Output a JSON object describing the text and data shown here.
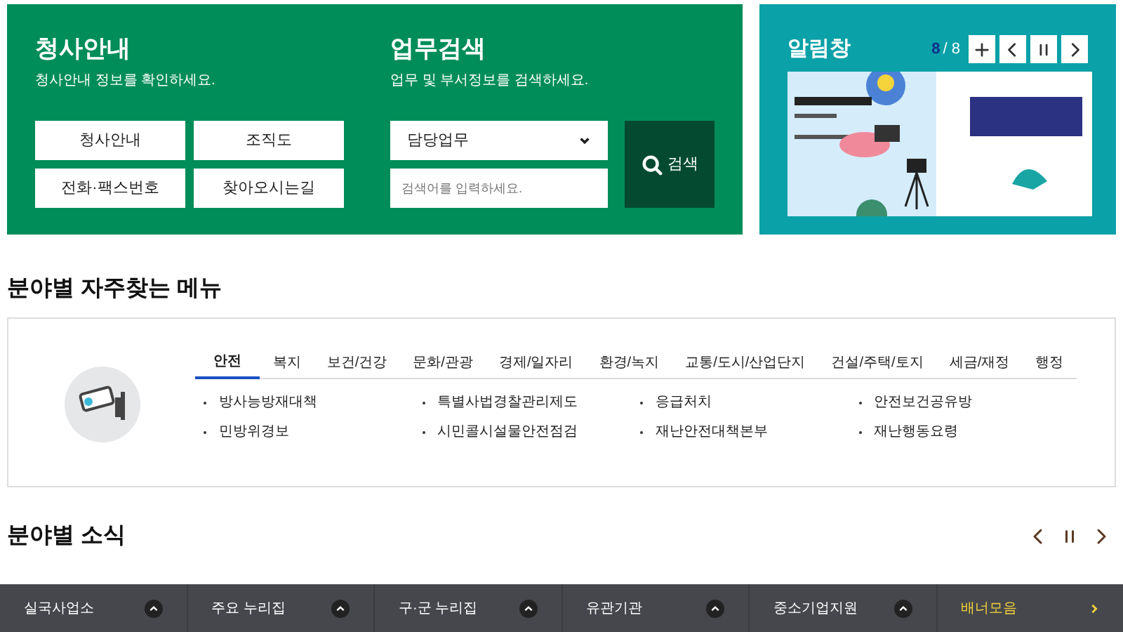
{
  "office": {
    "title": "청사안내",
    "subtitle": "청사안내 정보를 확인하세요.",
    "links": [
      "청사안내",
      "조직도",
      "전화·팩스번호",
      "찾아오시는길"
    ]
  },
  "search": {
    "title": "업무검색",
    "subtitle": "업무 및 부서정보를 검색하세요.",
    "select_value": "담당업무",
    "placeholder": "검색어를 입력하세요.",
    "button": "검색"
  },
  "notice": {
    "title": "알림창",
    "current": "8",
    "total": "/ 8",
    "controls": [
      {
        "kind": "plus"
      },
      {
        "kind": "prev"
      },
      {
        "kind": "pause"
      },
      {
        "kind": "next"
      }
    ]
  },
  "frequent": {
    "title": "분야별 자주찾는 메뉴",
    "tabs": [
      {
        "label": "안전",
        "selected": true
      },
      {
        "label": "복지",
        "selected": false
      },
      {
        "label": "보건/건강",
        "selected": false
      },
      {
        "label": "문화/관광",
        "selected": false
      },
      {
        "label": "경제/일자리",
        "selected": false
      },
      {
        "label": "환경/녹지",
        "selected": false
      },
      {
        "label": "교통/도시/산업단지",
        "selected": false
      },
      {
        "label": "건설/주택/토지",
        "selected": false
      },
      {
        "label": "세금/재정",
        "selected": false
      },
      {
        "label": "행정",
        "selected": false
      }
    ],
    "items": [
      "방사능방재대책",
      "특별사법경찰관리제도",
      "응급처치",
      "안전보건공유방",
      "민방위경보",
      "시민콜시설물안전점검",
      "재난안전대책본부",
      "재난행동요령"
    ]
  },
  "news": {
    "title": "분야별 소식",
    "controls": [
      {
        "kind": "prev"
      },
      {
        "kind": "pause"
      },
      {
        "kind": "next"
      }
    ],
    "bar": [
      {
        "label": "실국사업소",
        "kind": "dropdown"
      },
      {
        "label": "주요 누리집",
        "kind": "dropdown"
      },
      {
        "label": "구·군 누리집",
        "kind": "dropdown"
      },
      {
        "label": "유관기관",
        "kind": "dropdown"
      },
      {
        "label": "중소기업지원",
        "kind": "dropdown"
      },
      {
        "label": "배너모음",
        "kind": "link"
      }
    ]
  }
}
